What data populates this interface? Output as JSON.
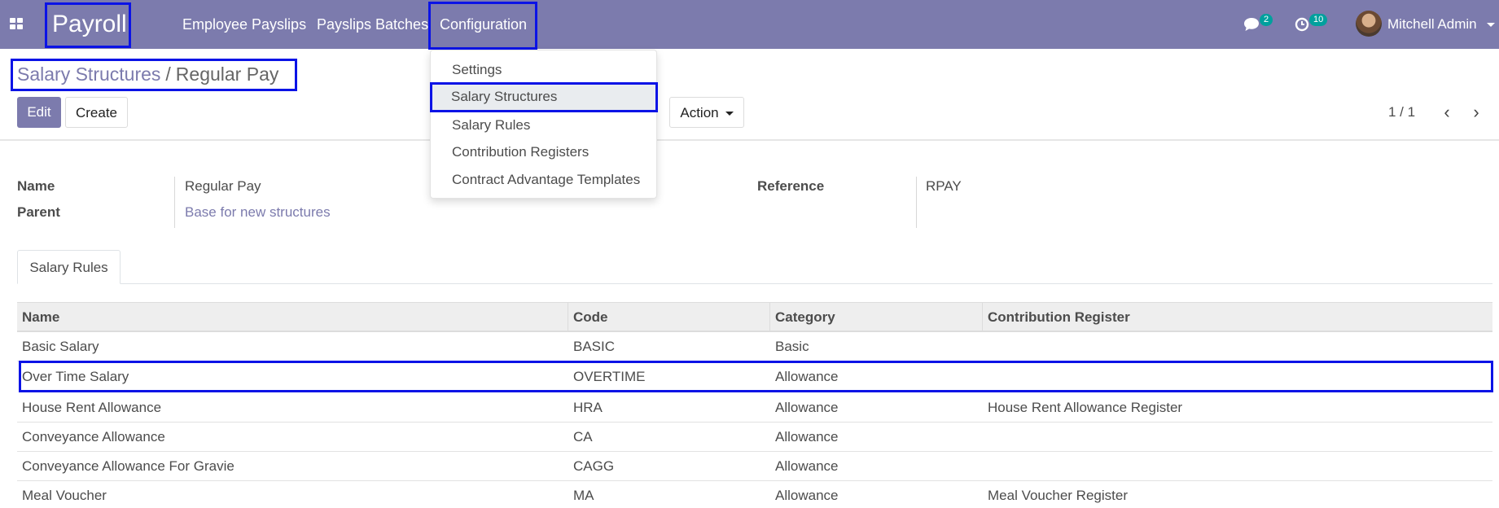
{
  "navbar": {
    "app_name": "Payroll",
    "menu": [
      "Employee Payslips",
      "Payslips Batches",
      "Configuration"
    ],
    "messages_count": "2",
    "activities_count": "10",
    "user_name": "Mitchell Admin"
  },
  "breadcrumb": {
    "parent": "Salary Structures",
    "separator": "/",
    "current": "Regular Pay"
  },
  "controls": {
    "edit_label": "Edit",
    "create_label": "Create",
    "action_label": "Action",
    "pager": "1 / 1"
  },
  "dropdown": {
    "items": [
      "Settings",
      "Salary Structures",
      "Salary Rules",
      "Contribution Registers",
      "Contract Advantage Templates"
    ],
    "active_index": 1
  },
  "form": {
    "name_label": "Name",
    "name_value": "Regular Pay",
    "parent_label": "Parent",
    "parent_value": "Base for new structures",
    "reference_label": "Reference",
    "reference_value": "RPAY"
  },
  "tabs": [
    "Salary Rules"
  ],
  "table": {
    "columns": [
      "Name",
      "Code",
      "Category",
      "Contribution Register"
    ],
    "rows": [
      [
        "Basic Salary",
        "BASIC",
        "Basic",
        ""
      ],
      [
        "Over Time Salary",
        "OVERTIME",
        "Allowance",
        ""
      ],
      [
        "House Rent Allowance",
        "HRA",
        "Allowance",
        "House Rent Allowance Register"
      ],
      [
        "Conveyance Allowance",
        "CA",
        "Allowance",
        ""
      ],
      [
        "Conveyance Allowance For Gravie",
        "CAGG",
        "Allowance",
        ""
      ],
      [
        "Meal Voucher",
        "MA",
        "Allowance",
        "Meal Voucher Register"
      ]
    ]
  },
  "colors": {
    "brand": "#7c7bad",
    "highlight_box": "#0b13e6",
    "badge": "#00a09d"
  }
}
